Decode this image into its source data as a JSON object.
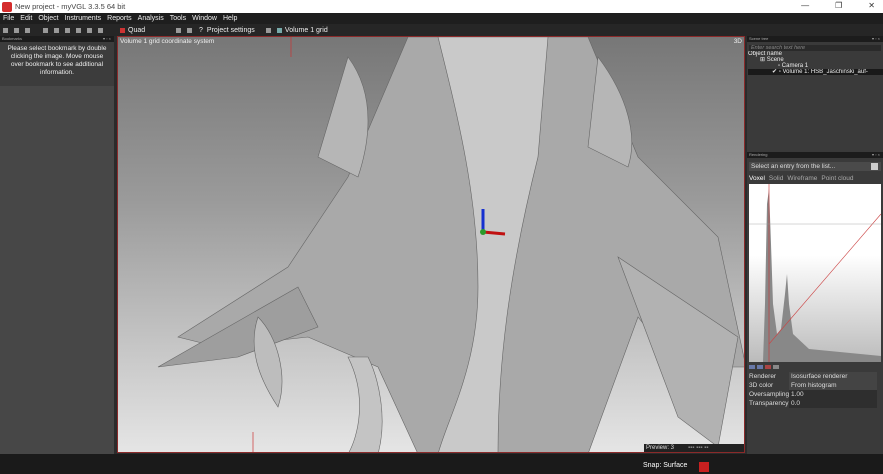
{
  "window": {
    "title": "New project  - myVGL 3.3.5 64 bit",
    "controls": [
      "—",
      "❐",
      "✕"
    ]
  },
  "menu": [
    "File",
    "Edit",
    "Object",
    "Instruments",
    "Reports",
    "Analysis",
    "Tools",
    "Window",
    "Help"
  ],
  "toolbar": {
    "layout": "Quad",
    "project_settings": "Project settings",
    "volume_grid": "Volume 1 grid"
  },
  "bookmarks": {
    "title": "Bookmarks",
    "message": "Please select bookmark by double clicking the image. Move mouse over bookmark to see additional information."
  },
  "viewport": {
    "label": "Volume 1 grid coordinate system",
    "mode": "3D",
    "preview": "Preview: 3"
  },
  "scene_tree": {
    "title": "Scene tree",
    "search_placeholder": "Enter search text here",
    "header": "Object name",
    "items": [
      "Scene",
      "Camera 1",
      "Volume 1: HSB_Jaschinski_auf-"
    ]
  },
  "rendering": {
    "title": "Rendering",
    "select": "Select an entry from the list...",
    "tabs": [
      "Voxel",
      "Solid",
      "Wireframe",
      "Point cloud"
    ],
    "props": [
      {
        "k": "Renderer",
        "v": "Isosurface renderer"
      },
      {
        "k": "3D color",
        "v": "From histogram"
      },
      {
        "k": "Oversampling",
        "v": "1.00"
      },
      {
        "k": "Transparency",
        "v": "0.0"
      }
    ]
  },
  "status": {
    "snap": "Snap: Surface"
  }
}
